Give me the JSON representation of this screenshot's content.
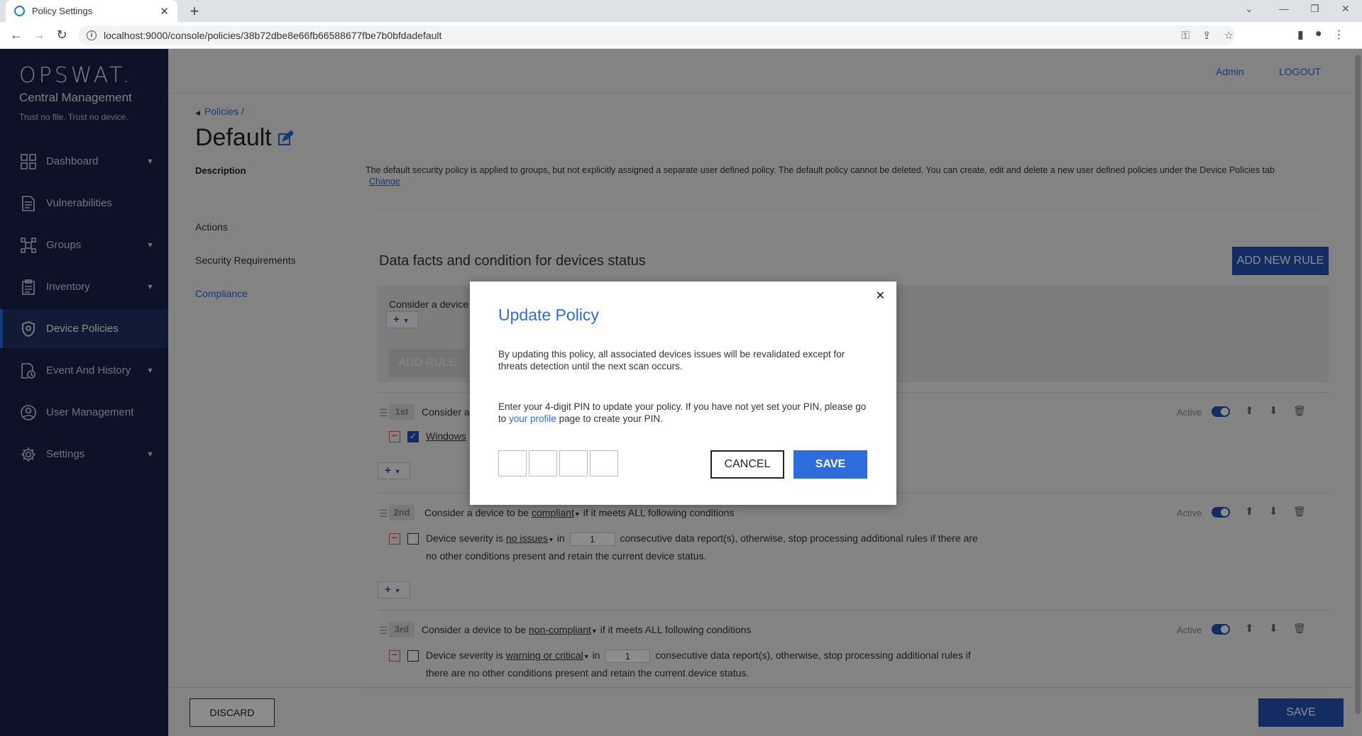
{
  "browser": {
    "tab_title": "Policy Settings",
    "url": "localhost:9000/console/policies/38b72dbe8e66fb66588677fbe7b0bfdadefault"
  },
  "sidebar": {
    "logo": "OPSWAT.",
    "product": "Central Management",
    "tagline": "Trust no file. Trust no device.",
    "items": [
      {
        "label": "Dashboard",
        "icon": "dashboard-icon"
      },
      {
        "label": "Vulnerabilities",
        "icon": "document-icon"
      },
      {
        "label": "Groups",
        "icon": "groups-icon"
      },
      {
        "label": "Inventory",
        "icon": "clipboard-icon"
      },
      {
        "label": "Device Policies",
        "icon": "shield-icon"
      },
      {
        "label": "Event And History",
        "icon": "history-icon"
      },
      {
        "label": "User Management",
        "icon": "user-icon"
      },
      {
        "label": "Settings",
        "icon": "gear-icon"
      }
    ]
  },
  "header": {
    "admin": "Admin",
    "logout": "LOGOUT"
  },
  "page": {
    "breadcrumb": "Policies /",
    "title": "Default",
    "description_label": "Description",
    "description_text": "The default security policy is applied to groups, but not explicitly assigned a separate user defined policy. The default policy cannot be deleted. You can create, edit and delete a new user defined policies under the Device Policies tab",
    "change_link": "Change",
    "menu": [
      "Actions",
      "Security Requirements",
      "Compliance"
    ]
  },
  "panel": {
    "title": "Data facts and condition for devices status",
    "add_new_rule": "ADD NEW RULE",
    "consider_text": "Consider a device",
    "add_rule": "ADD RULE",
    "active_label": "Active",
    "rules": [
      {
        "order": "1st",
        "prefix": "Consider a",
        "condition": "Windows"
      },
      {
        "order": "2nd",
        "prefix": "Consider a device to be",
        "status": "compliant",
        "suffix": "if it meets ALL following conditions",
        "line_prefix": "Device severity is",
        "severity": "no issues",
        "in": "in",
        "count": "1",
        "line_suffix": "consecutive data report(s), otherwise, stop processing additional rules if there are",
        "line2": "no other conditions present and retain the current device status."
      },
      {
        "order": "3rd",
        "prefix": "Consider a device to be",
        "status": "non-compliant",
        "suffix": "if it meets ALL following conditions",
        "line_prefix": "Device severity is",
        "severity": "warning or critical",
        "in": "in",
        "count": "1",
        "line_suffix": "consecutive data report(s), otherwise, stop processing additional rules if",
        "line2": "there are no other conditions present and retain the current device status."
      }
    ]
  },
  "footer": {
    "discard": "DISCARD",
    "save": "SAVE"
  },
  "modal": {
    "title": "Update Policy",
    "paragraph1": "By updating this policy, all associated devices issues will be revalidated except for threats detection until the next scan occurs.",
    "paragraph2_before": "Enter your 4-digit PIN to update your policy. If you have not yet set your PIN, please go to",
    "paragraph2_link": "your profile",
    "paragraph2_after": "page to create your PIN.",
    "cancel": "CANCEL",
    "save": "SAVE"
  }
}
